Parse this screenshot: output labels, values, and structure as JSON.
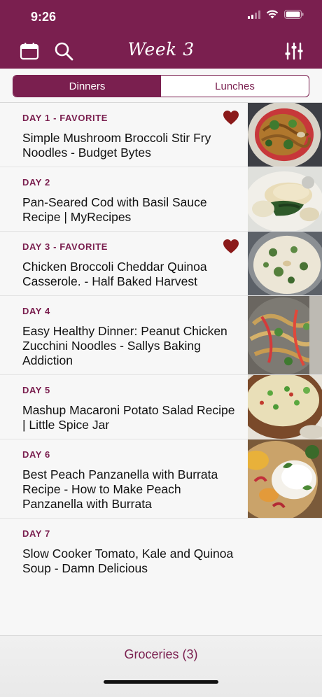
{
  "status": {
    "time": "9:26"
  },
  "nav": {
    "title": "Week 3"
  },
  "segments": {
    "dinners": "Dinners",
    "lunches": "Lunches",
    "selected": "Dinners"
  },
  "meals": [
    {
      "day": "DAY 1 - FAVORITE",
      "title": "Simple Mushroom Broccoli Stir Fry Noodles - Budget Bytes",
      "favorite": true,
      "thumbnail": "noodles-photo"
    },
    {
      "day": "DAY 2",
      "title": "Pan-Seared Cod with Basil Sauce Recipe | MyRecipes",
      "favorite": false,
      "thumbnail": "cod-photo"
    },
    {
      "day": "DAY 3 - FAVORITE",
      "title": "Chicken Broccoli Cheddar Quinoa Casserole. - Half Baked Harvest",
      "favorite": true,
      "thumbnail": "casserole-photo"
    },
    {
      "day": "DAY 4",
      "title": "Easy Healthy Dinner: Peanut Chicken Zucchini Noodles - Sallys Baking Addiction",
      "favorite": false,
      "thumbnail": "zucchini-noodles-photo"
    },
    {
      "day": "DAY 5",
      "title": "Mashup Macaroni Potato Salad Recipe | Little Spice Jar",
      "favorite": false,
      "thumbnail": "macaroni-salad-photo"
    },
    {
      "day": "DAY 6",
      "title": "Best Peach Panzanella with Burrata Recipe - How to Make Peach Panzanella with Burrata",
      "favorite": false,
      "thumbnail": "panzanella-photo"
    },
    {
      "day": "DAY 7",
      "title": "Slow Cooker Tomato, Kale and Quinoa Soup - Damn Delicious",
      "favorite": false,
      "thumbnail": null
    }
  ],
  "footer": {
    "groceries": "Groceries (3)"
  },
  "colors": {
    "brand": "#7a1f4f",
    "heart": "#8b1a1a"
  }
}
